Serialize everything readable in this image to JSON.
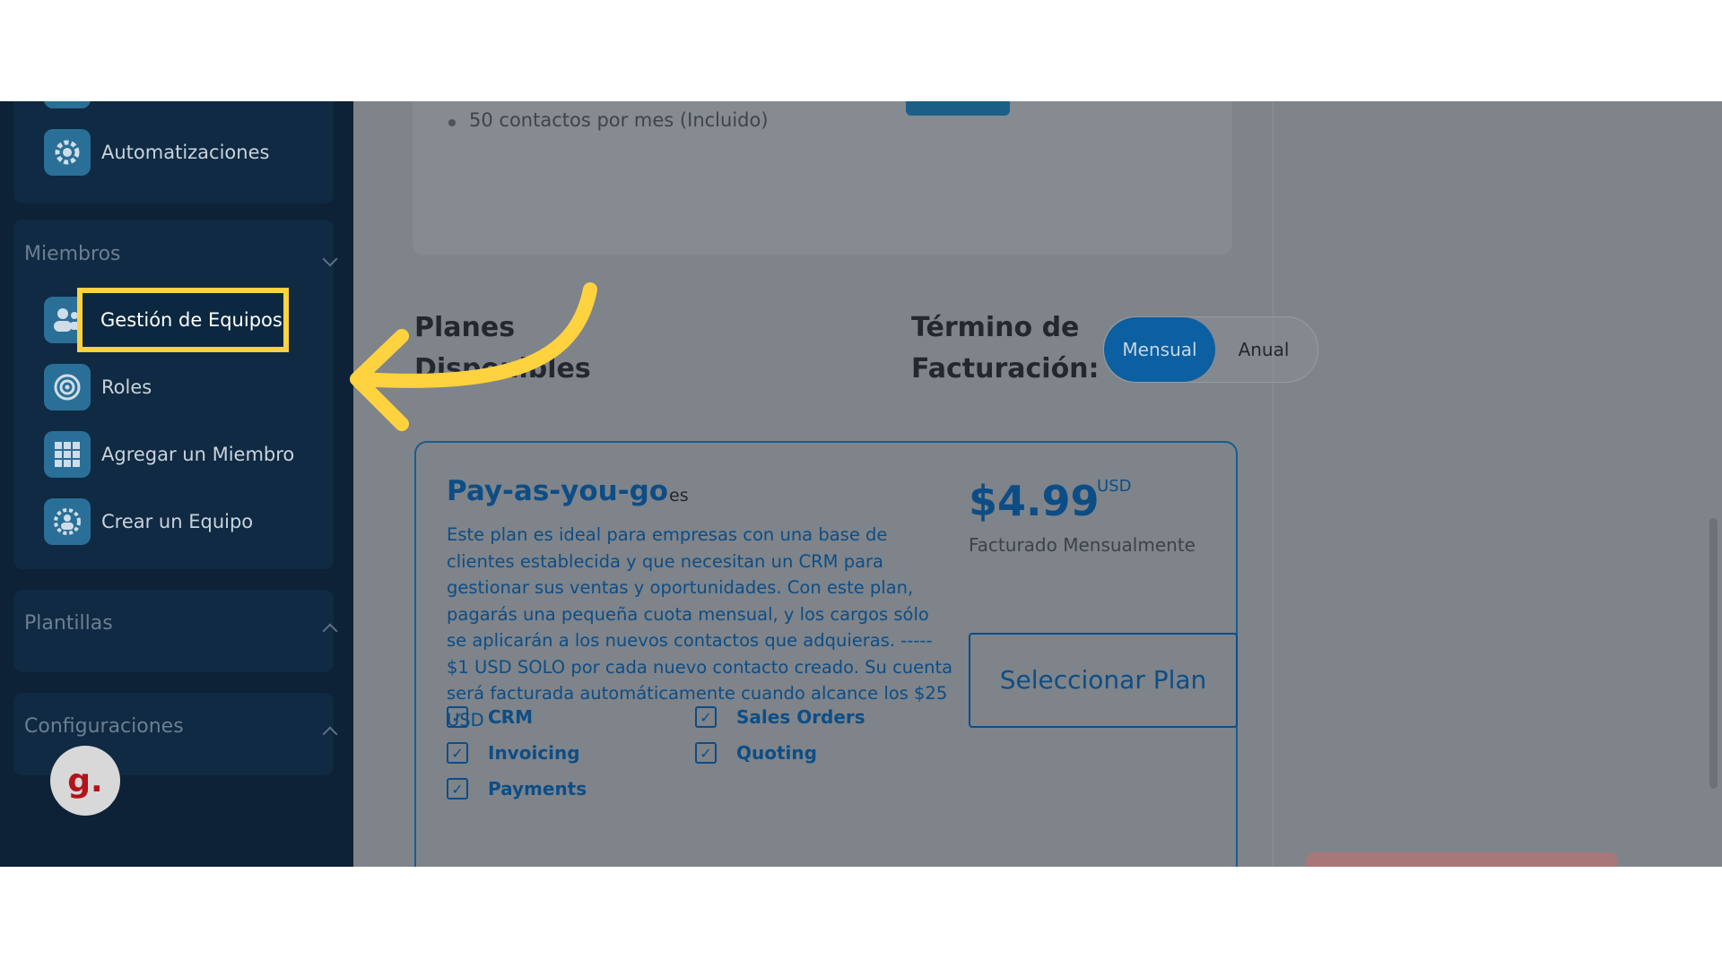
{
  "sidebar": {
    "automations_label": "Automatizaciones",
    "members_section": {
      "title": "Miembros",
      "items": [
        {
          "label": "Gestión de Equipos",
          "icon": "people-icon"
        },
        {
          "label": "Roles",
          "icon": "target-icon"
        },
        {
          "label": "Agregar un Miembro",
          "icon": "grid-icon"
        },
        {
          "label": "Crear un Equipo",
          "icon": "group-gear-icon"
        }
      ]
    },
    "templates_section": {
      "title": "Plantillas"
    },
    "settings_section": {
      "title": "Configuraciones"
    },
    "avatar_letter": "g."
  },
  "main": {
    "top_bullet": "50 contactos por mes (Incluido)",
    "plans_title_line1": "Planes",
    "plans_title_line2": "Disponibles",
    "term_title_line1": "Término de",
    "term_title_line2": "Facturación:",
    "toggle": {
      "active": "Mensual",
      "inactive": "Anual"
    },
    "plan": {
      "name": "Pay-as-you-go",
      "lang": "es",
      "description": "Este plan es ideal para empresas con una base de clientes establecida y que necesitan un CRM para gestionar sus ventas y oportunidades. Con este plan, pagarás una pequeña cuota mensual, y los cargos sólo se aplicarán a los nuevos contactos que adquieras. ----- $1 USD SOLO por cada nuevo contacto creado. Su cuenta será facturada automáticamente cuando alcance los $25 USD ---",
      "price": "$4.99",
      "currency": "USD",
      "billed": "Facturado Mensualmente",
      "select_button": "Seleccionar Plan",
      "features": [
        "CRM",
        "Sales Orders",
        "Invoicing",
        "Quoting",
        "Payments"
      ]
    }
  },
  "colors": {
    "highlight": "#ffd23f",
    "sidebar_bg": "#0d2236",
    "primary": "#0d4d86"
  }
}
